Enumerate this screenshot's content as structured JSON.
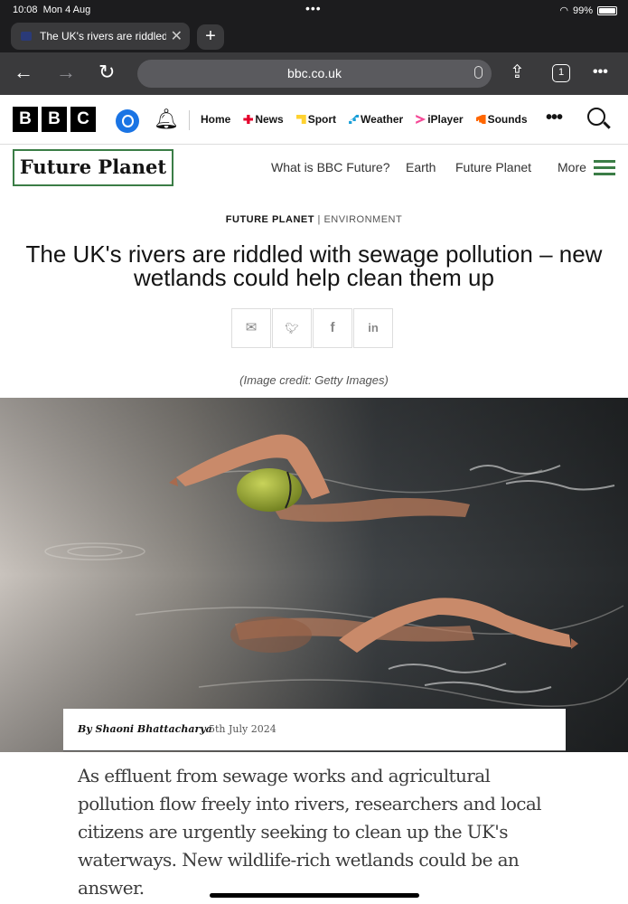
{
  "status": {
    "time": "10:08",
    "date": "Mon 4 Aug",
    "battery": "99%"
  },
  "browser": {
    "tab_title": "The UK's rivers are riddled",
    "url": "bbc.co.uk",
    "tab_count": "1"
  },
  "bbc_nav": {
    "links": [
      "Home",
      "News",
      "Sport",
      "Weather",
      "iPlayer",
      "Sounds"
    ],
    "colors": {
      "news": "#e4002b",
      "sport": "#ffd230",
      "weather": "#1a9fd8",
      "iplayer": "#f54997",
      "sounds": "#ff6600"
    }
  },
  "future_nav": {
    "logo": "Future Planet",
    "links": [
      "What is BBC Future?",
      "Earth",
      "Future Planet"
    ],
    "more": "More",
    "accent": "#3b7d46"
  },
  "article": {
    "section": "FUTURE PLANET",
    "subsection": "ENVIRONMENT",
    "headline": "The UK's rivers are riddled with sewage pollution – new wetlands could help clean them up",
    "share_icons": [
      "email-icon",
      "twitter-icon",
      "facebook-icon",
      "linkedin-icon"
    ],
    "image_credit": "(Image credit: Getty Images)",
    "byline": "By Shaoni Bhattacharya",
    "date": "5th July 2024",
    "standfirst": "As effluent from sewage works and agricultural pollution flow freely into rivers, researchers and local citizens are urgently seeking to clean up the UK's waterways. New wildlife-rich wetlands could be an answer."
  }
}
